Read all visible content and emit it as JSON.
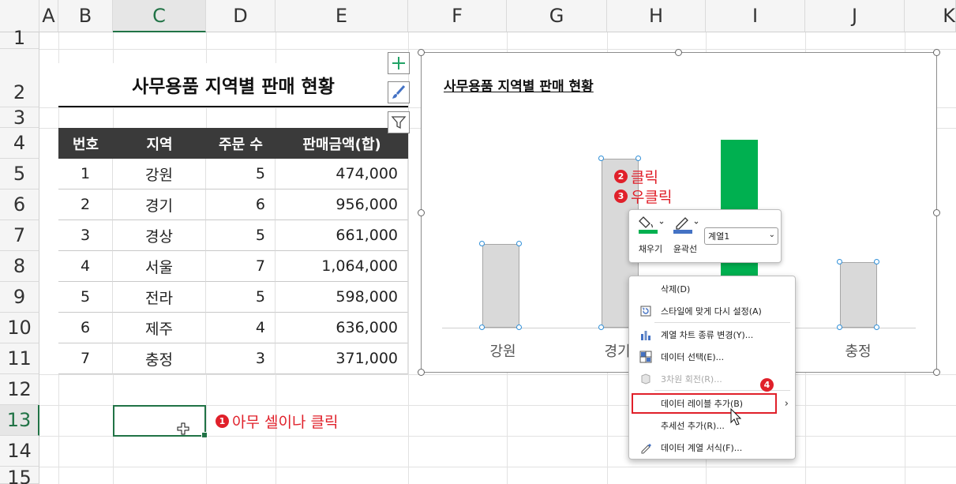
{
  "columns": [
    "A",
    "B",
    "C",
    "D",
    "E",
    "F",
    "G",
    "H",
    "I",
    "J",
    "K"
  ],
  "rows": [
    "1",
    "2",
    "3",
    "4",
    "5",
    "6",
    "7",
    "8",
    "9",
    "10",
    "11",
    "12",
    "13",
    "14",
    "15"
  ],
  "sheet": {
    "title": "사무용품 지역별 판매 현황",
    "headers": [
      "번호",
      "지역",
      "주문 수",
      "판매금액(합)"
    ],
    "data": [
      [
        "1",
        "강원",
        "5",
        "474,000"
      ],
      [
        "2",
        "경기",
        "6",
        "956,000"
      ],
      [
        "3",
        "경상",
        "5",
        "661,000"
      ],
      [
        "4",
        "서울",
        "7",
        "1,064,000"
      ],
      [
        "5",
        "전라",
        "5",
        "598,000"
      ],
      [
        "6",
        "제주",
        "4",
        "636,000"
      ],
      [
        "7",
        "충정",
        "3",
        "371,000"
      ]
    ]
  },
  "annotations": {
    "a1": {
      "badge": "1",
      "text": "아무 셀이나 클릭"
    },
    "a2": {
      "badge": "2",
      "text": "클릭"
    },
    "a3": {
      "badge": "3",
      "text": "우클릭"
    },
    "a4": {
      "badge": "4"
    }
  },
  "chart_data": {
    "type": "bar",
    "title": "사무용품 지역별 판매 현황",
    "categories_visible": [
      "강원",
      "경기",
      "충정"
    ],
    "categories": [
      "강원",
      "경기",
      "경상",
      "서울",
      "전라",
      "제주",
      "충정"
    ],
    "values": [
      474000,
      956000,
      661000,
      1064000,
      598000,
      636000,
      371000
    ],
    "selected_series_visible": [
      "강원",
      "경기",
      "서울",
      "충정"
    ],
    "highlight_color": "#00b050",
    "bar_color": "#d9d9d9"
  },
  "minibar": {
    "fill_label": "채우기",
    "outline_label": "윤곽선",
    "series_select": "계열1",
    "fill_color": "#00b050",
    "outline_color": "#4472c4"
  },
  "context_menu": {
    "items": [
      {
        "label": "삭제(D)",
        "icon": "none",
        "disabled": false
      },
      {
        "label": "스타일에 맞게 다시 설정(A)",
        "icon": "reset-style-icon",
        "disabled": false
      },
      {
        "label": "계열 차트 종류 변경(Y)...",
        "icon": "chart-type-icon",
        "disabled": false
      },
      {
        "label": "데이터 선택(E)...",
        "icon": "select-data-icon",
        "disabled": false
      },
      {
        "label": "3차원 회전(R)...",
        "icon": "rotate-3d-icon",
        "disabled": true
      },
      {
        "label": "데이터 레이블 추가(B)",
        "icon": "none",
        "disabled": false,
        "submenu": true
      },
      {
        "label": "추세선 추가(R)...",
        "icon": "none",
        "disabled": false
      },
      {
        "label": "데이터 계열 서식(F)...",
        "icon": "format-series-icon",
        "disabled": false
      }
    ]
  }
}
